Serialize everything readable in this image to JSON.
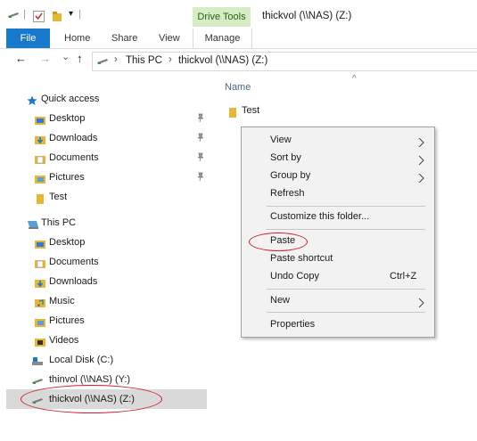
{
  "quick_toolbar": {
    "separator": "|",
    "dropdown_glyph": "▾"
  },
  "ribbon": {
    "contextual_group": "Drive Tools",
    "window_title": "thickvol (\\\\NAS) (Z:)",
    "tabs": [
      "File",
      "Home",
      "Share",
      "View",
      "Manage"
    ]
  },
  "address": {
    "back": "←",
    "forward": "→",
    "recent": "⌄",
    "up": "↑",
    "crumbs": [
      "This PC",
      "thickvol (\\\\NAS) (Z:)"
    ],
    "crumb_sep": "›"
  },
  "nav": {
    "quick_access": {
      "label": "Quick access",
      "items": [
        {
          "label": "Desktop",
          "pinned": true
        },
        {
          "label": "Downloads",
          "pinned": true
        },
        {
          "label": "Documents",
          "pinned": true
        },
        {
          "label": "Pictures",
          "pinned": true
        },
        {
          "label": "Test",
          "pinned": false
        }
      ]
    },
    "this_pc": {
      "label": "This PC",
      "items": [
        {
          "label": "Desktop"
        },
        {
          "label": "Documents"
        },
        {
          "label": "Downloads"
        },
        {
          "label": "Music"
        },
        {
          "label": "Pictures"
        },
        {
          "label": "Videos"
        },
        {
          "label": "Local Disk (C:)"
        },
        {
          "label": "thinvol (\\\\NAS) (Y:)"
        },
        {
          "label": "thickvol (\\\\NAS) (Z:)"
        }
      ]
    }
  },
  "content": {
    "column_name": "Name",
    "sort_glyph": "^",
    "files": [
      "Test"
    ]
  },
  "context_menu": {
    "view": "View",
    "sort_by": "Sort by",
    "group_by": "Group by",
    "refresh": "Refresh",
    "customize": "Customize this folder...",
    "paste": "Paste",
    "paste_shortcut": "Paste shortcut",
    "undo_copy": "Undo Copy",
    "undo_copy_shortcut": "Ctrl+Z",
    "new": "New",
    "properties": "Properties"
  },
  "colors": {
    "file_tab": "#1979ca",
    "drive_tools": "#d6ecc4",
    "folder": "#e8b634",
    "annotation": "#d21b2b",
    "selection": "#d9d9d9"
  }
}
